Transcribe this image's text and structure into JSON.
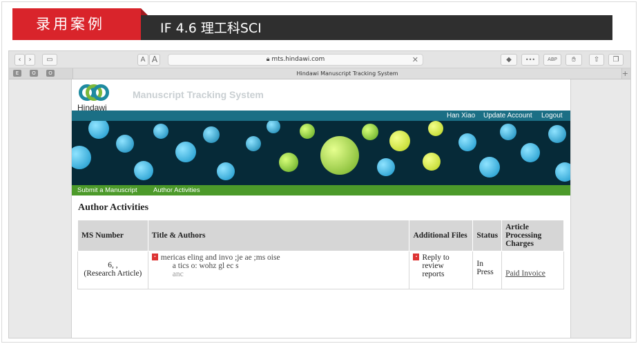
{
  "banner": {
    "tag": "录用案例",
    "title": "IF 4.6  理工科SCI"
  },
  "browser": {
    "url": "mts.hindawi.com",
    "tab_title": "Hindawi Manuscript Tracking System",
    "font_small": "A",
    "font_large": "A",
    "ext_labels": [
      "E",
      "O",
      "O"
    ],
    "abp": "ABP",
    "dots": "•••"
  },
  "site": {
    "logo_text": "Hindawi",
    "system_title": "Manuscript Tracking System",
    "user_name": "Han Xiao",
    "update_account": "Update Account",
    "logout": "Logout",
    "nav": [
      "Submit a Manuscript",
      "Author Activities"
    ],
    "section_title": "Author Activities"
  },
  "table": {
    "headers": [
      "MS Number",
      "Title & Authors",
      "Additional Files",
      "Status",
      "Article Processing Charges"
    ],
    "row": {
      "ms_number_line1": "6,  ,",
      "ms_number_line2": "(Research Article)",
      "title_line1": "mericas     eling and invo    ;je       ae    ;ms       oise",
      "title_line2": "a     tics o:      wohz      gl      ec         s",
      "title_line3": "        anc",
      "files": "Reply to review reports",
      "status": "In Press",
      "charges": "Paid Invoice"
    }
  }
}
